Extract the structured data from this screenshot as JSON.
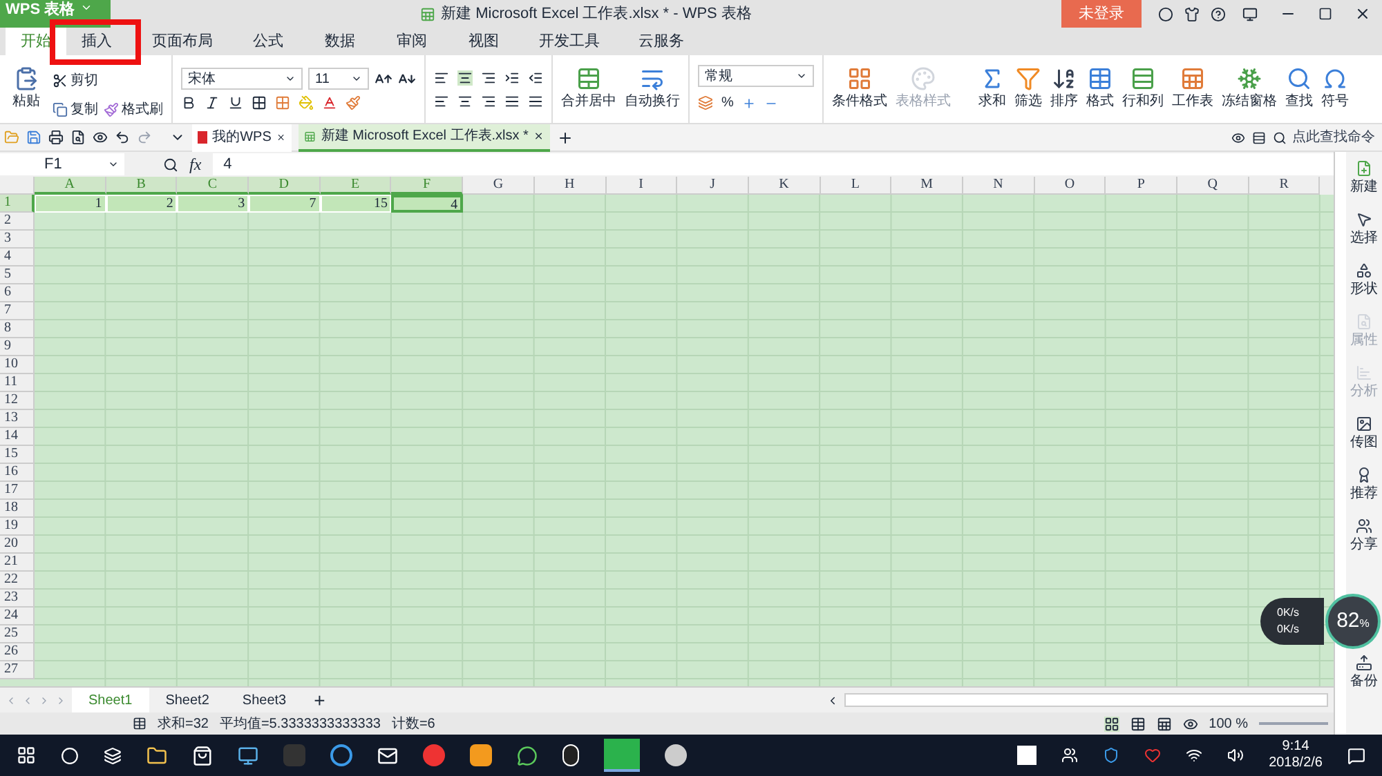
{
  "title_bar": {
    "app_menu": "WPS 表格",
    "title": "新建 Microsoft Excel 工作表.xlsx * - WPS 表格",
    "login": "未登录"
  },
  "menu_tabs": [
    {
      "label": "开始",
      "selected": true
    },
    {
      "label": "插入",
      "selected": false
    },
    {
      "label": "页面布局",
      "selected": false
    },
    {
      "label": "公式",
      "selected": false
    },
    {
      "label": "数据",
      "selected": false
    },
    {
      "label": "审阅",
      "selected": false
    },
    {
      "label": "视图",
      "selected": false
    },
    {
      "label": "开发工具",
      "selected": false
    },
    {
      "label": "云服务",
      "selected": false
    }
  ],
  "annotation": {
    "kind": "highlight-box"
  },
  "ribbon": {
    "paste": "粘贴",
    "cut": "剪切",
    "copy": "复制",
    "format_painter": "格式刷",
    "font": "宋体",
    "font_size": "11",
    "merge": "合并居中",
    "wrap": "自动换行",
    "number_format": "常规",
    "percent": "%",
    "tools": [
      {
        "label": "条件格式",
        "disabled": false
      },
      {
        "label": "表格样式",
        "disabled": true
      },
      {
        "label": "求和",
        "disabled": false
      },
      {
        "label": "筛选",
        "disabled": false
      },
      {
        "label": "排序",
        "disabled": false
      },
      {
        "label": "格式",
        "disabled": false
      },
      {
        "label": "行和列",
        "disabled": false
      },
      {
        "label": "工作表",
        "disabled": false
      },
      {
        "label": "冻结窗格",
        "disabled": false
      },
      {
        "label": "查找",
        "disabled": false
      },
      {
        "label": "符号",
        "disabled": false
      }
    ]
  },
  "doc_tabs": [
    {
      "label": "我的WPS",
      "selected": false
    },
    {
      "label": "新建 Microsoft Excel 工作表.xlsx *",
      "selected": true
    }
  ],
  "command_search": {
    "placeholder": "点此查找命令"
  },
  "formula_bar": {
    "name_box": "F1",
    "fx": "fx",
    "value": "4"
  },
  "columns": [
    {
      "label": "A",
      "selected": true
    },
    {
      "label": "B",
      "selected": true
    },
    {
      "label": "C",
      "selected": true
    },
    {
      "label": "D",
      "selected": true
    },
    {
      "label": "E",
      "selected": true
    },
    {
      "label": "F",
      "selected": true
    },
    {
      "label": "G",
      "selected": false
    },
    {
      "label": "H",
      "selected": false
    },
    {
      "label": "I",
      "selected": false
    },
    {
      "label": "J",
      "selected": false
    },
    {
      "label": "K",
      "selected": false
    },
    {
      "label": "L",
      "selected": false
    },
    {
      "label": "M",
      "selected": false
    },
    {
      "label": "N",
      "selected": false
    },
    {
      "label": "O",
      "selected": false
    },
    {
      "label": "P",
      "selected": false
    },
    {
      "label": "Q",
      "selected": false
    },
    {
      "label": "R",
      "selected": false
    }
  ],
  "rows": [
    {
      "header": "1",
      "selected": true,
      "cells": [
        {
          "value": "1",
          "selected": true,
          "active": false
        },
        {
          "value": "2",
          "selected": true,
          "active": false
        },
        {
          "value": "3",
          "selected": true,
          "active": false
        },
        {
          "value": "7",
          "selected": true,
          "active": false
        },
        {
          "value": "15",
          "selected": true,
          "active": false
        },
        {
          "value": "4",
          "selected": true,
          "active": true
        }
      ]
    },
    {
      "header": "2",
      "selected": false
    },
    {
      "header": "3",
      "selected": false
    },
    {
      "header": "4",
      "selected": false
    },
    {
      "header": "5",
      "selected": false
    },
    {
      "header": "6",
      "selected": false
    },
    {
      "header": "7",
      "selected": false
    },
    {
      "header": "8",
      "selected": false
    },
    {
      "header": "9",
      "selected": false
    },
    {
      "header": "10",
      "selected": false
    },
    {
      "header": "11",
      "selected": false
    },
    {
      "header": "12",
      "selected": false
    },
    {
      "header": "13",
      "selected": false
    },
    {
      "header": "14",
      "selected": false
    },
    {
      "header": "15",
      "selected": false
    },
    {
      "header": "16",
      "selected": false
    },
    {
      "header": "17",
      "selected": false
    },
    {
      "header": "18",
      "selected": false
    },
    {
      "header": "19",
      "selected": false
    },
    {
      "header": "20",
      "selected": false
    },
    {
      "header": "21",
      "selected": false
    },
    {
      "header": "22",
      "selected": false
    },
    {
      "header": "23",
      "selected": false
    },
    {
      "header": "24",
      "selected": false
    },
    {
      "header": "25",
      "selected": false
    },
    {
      "header": "26",
      "selected": false
    },
    {
      "header": "27",
      "selected": false
    }
  ],
  "sheet_tabs": [
    {
      "label": "Sheet1",
      "selected": true
    },
    {
      "label": "Sheet2",
      "selected": false
    },
    {
      "label": "Sheet3",
      "selected": false
    }
  ],
  "add_sheet": "+",
  "status_bar": {
    "items": [
      "求和=32",
      "平均值=5.3333333333333",
      "计数=6"
    ],
    "zoom": "100 %"
  },
  "side_panel": [
    {
      "label": "新建",
      "disabled": false
    },
    {
      "label": "选择",
      "disabled": false
    },
    {
      "label": "形状",
      "disabled": false
    },
    {
      "label": "属性",
      "disabled": true
    },
    {
      "label": "分析",
      "disabled": true
    },
    {
      "label": "传图",
      "disabled": false
    },
    {
      "label": "推荐",
      "disabled": false
    },
    {
      "label": "分享",
      "disabled": false
    },
    {
      "label": "备份",
      "disabled": false
    }
  ],
  "speed_widget": {
    "upload": "0K/s",
    "download": "0K/s",
    "percent": "82",
    "unit": "%"
  },
  "taskbar": {
    "time": "9:14",
    "date": "2018/2/6"
  }
}
